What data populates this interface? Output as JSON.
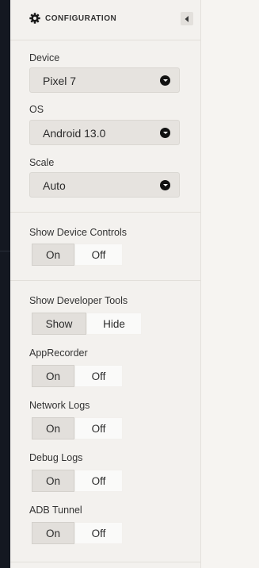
{
  "header": {
    "title": "CONFIGURATION",
    "gear_icon": "gear-icon",
    "collapse_icon": "caret-left-icon"
  },
  "device": {
    "label": "Device",
    "value": "Pixel 7"
  },
  "os": {
    "label": "OS",
    "value": "Android 13.0"
  },
  "scale": {
    "label": "Scale",
    "value": "Auto"
  },
  "device_controls": {
    "label": "Show Device Controls",
    "on": "On",
    "off": "Off",
    "selected": "On"
  },
  "developer_tools": {
    "label": "Show Developer Tools",
    "on": "Show",
    "off": "Hide",
    "selected": "Show"
  },
  "app_recorder": {
    "label": "AppRecorder",
    "on": "On",
    "off": "Off",
    "selected": "On"
  },
  "network_logs": {
    "label": "Network Logs",
    "on": "On",
    "off": "Off",
    "selected": "On"
  },
  "debug_logs": {
    "label": "Debug Logs",
    "on": "On",
    "off": "Off",
    "selected": "On"
  },
  "adb_tunnel": {
    "label": "ADB Tunnel",
    "on": "On",
    "off": "Off",
    "selected": "On"
  }
}
